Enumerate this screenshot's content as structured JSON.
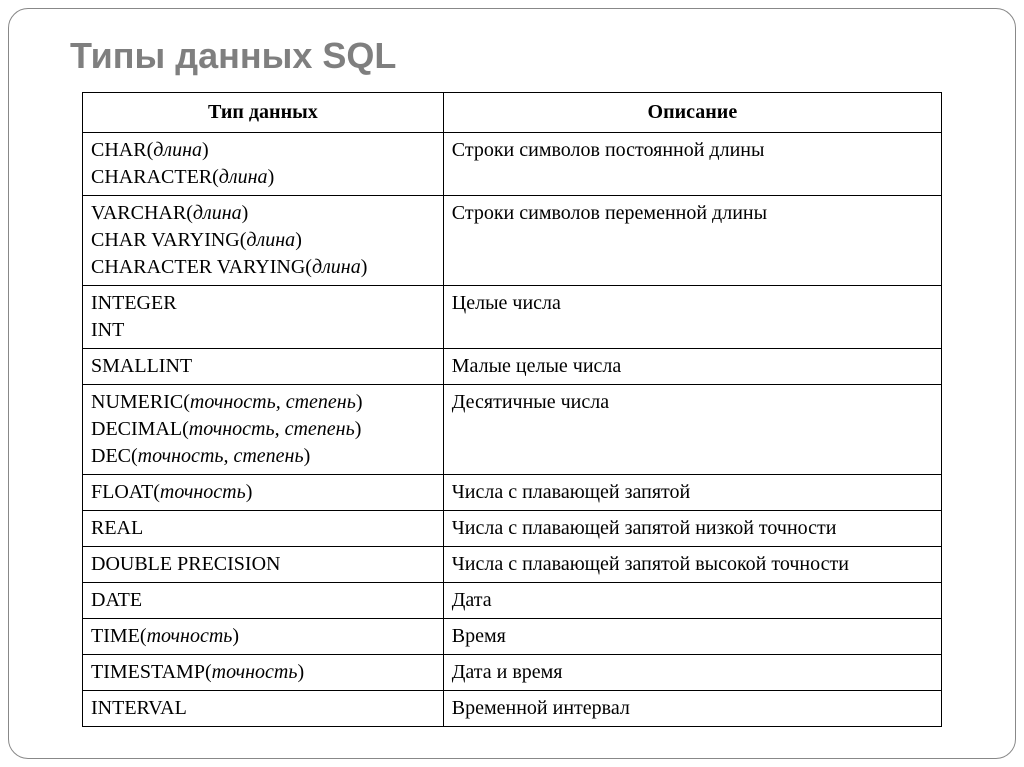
{
  "title": "Типы данных SQL",
  "headers": {
    "type": "Тип данных",
    "desc": "Описание"
  },
  "rows": [
    {
      "types": [
        {
          "name": "CHAR",
          "param": "длина"
        },
        {
          "name": "CHARACTER",
          "param": "длина"
        }
      ],
      "desc": "Строки символов постоянной длины"
    },
    {
      "types": [
        {
          "name": "VARCHAR",
          "param": "длина"
        },
        {
          "name": "CHAR VARYING",
          "param": "длина"
        },
        {
          "name": "CHARACTER VARYING",
          "param": "длина"
        }
      ],
      "desc": "Строки символов переменной длины"
    },
    {
      "types": [
        {
          "name": "INTEGER",
          "param": null
        },
        {
          "name": "INT",
          "param": null
        }
      ],
      "desc": "Целые числа"
    },
    {
      "types": [
        {
          "name": "SMALLINT",
          "param": null
        }
      ],
      "desc": "Малые целые числа"
    },
    {
      "types": [
        {
          "name": "NUMERIC",
          "param": "точность, степень"
        },
        {
          "name": "DECIMAL",
          "param": "точность, степень"
        },
        {
          "name": "DEC",
          "param": "точность, степень"
        }
      ],
      "desc": "Десятичные числа"
    },
    {
      "types": [
        {
          "name": "FLOAT",
          "param": "точность"
        }
      ],
      "desc": "Числа с плавающей запятой"
    },
    {
      "types": [
        {
          "name": "REAL",
          "param": null
        }
      ],
      "desc": "Числа с плавающей запятой низкой точности"
    },
    {
      "types": [
        {
          "name": "DOUBLE PRECISION",
          "param": null
        }
      ],
      "desc": "Числа с плавающей запятой высокой точности"
    },
    {
      "types": [
        {
          "name": "DATE",
          "param": null
        }
      ],
      "desc": "Дата"
    },
    {
      "types": [
        {
          "name": "TIME",
          "param": "точность"
        }
      ],
      "desc": "Время"
    },
    {
      "types": [
        {
          "name": "TIMESTAMP",
          "param": "точность"
        }
      ],
      "desc": "Дата и время"
    },
    {
      "types": [
        {
          "name": "INTERVAL",
          "param": null
        }
      ],
      "desc": "Временной интервал"
    }
  ]
}
